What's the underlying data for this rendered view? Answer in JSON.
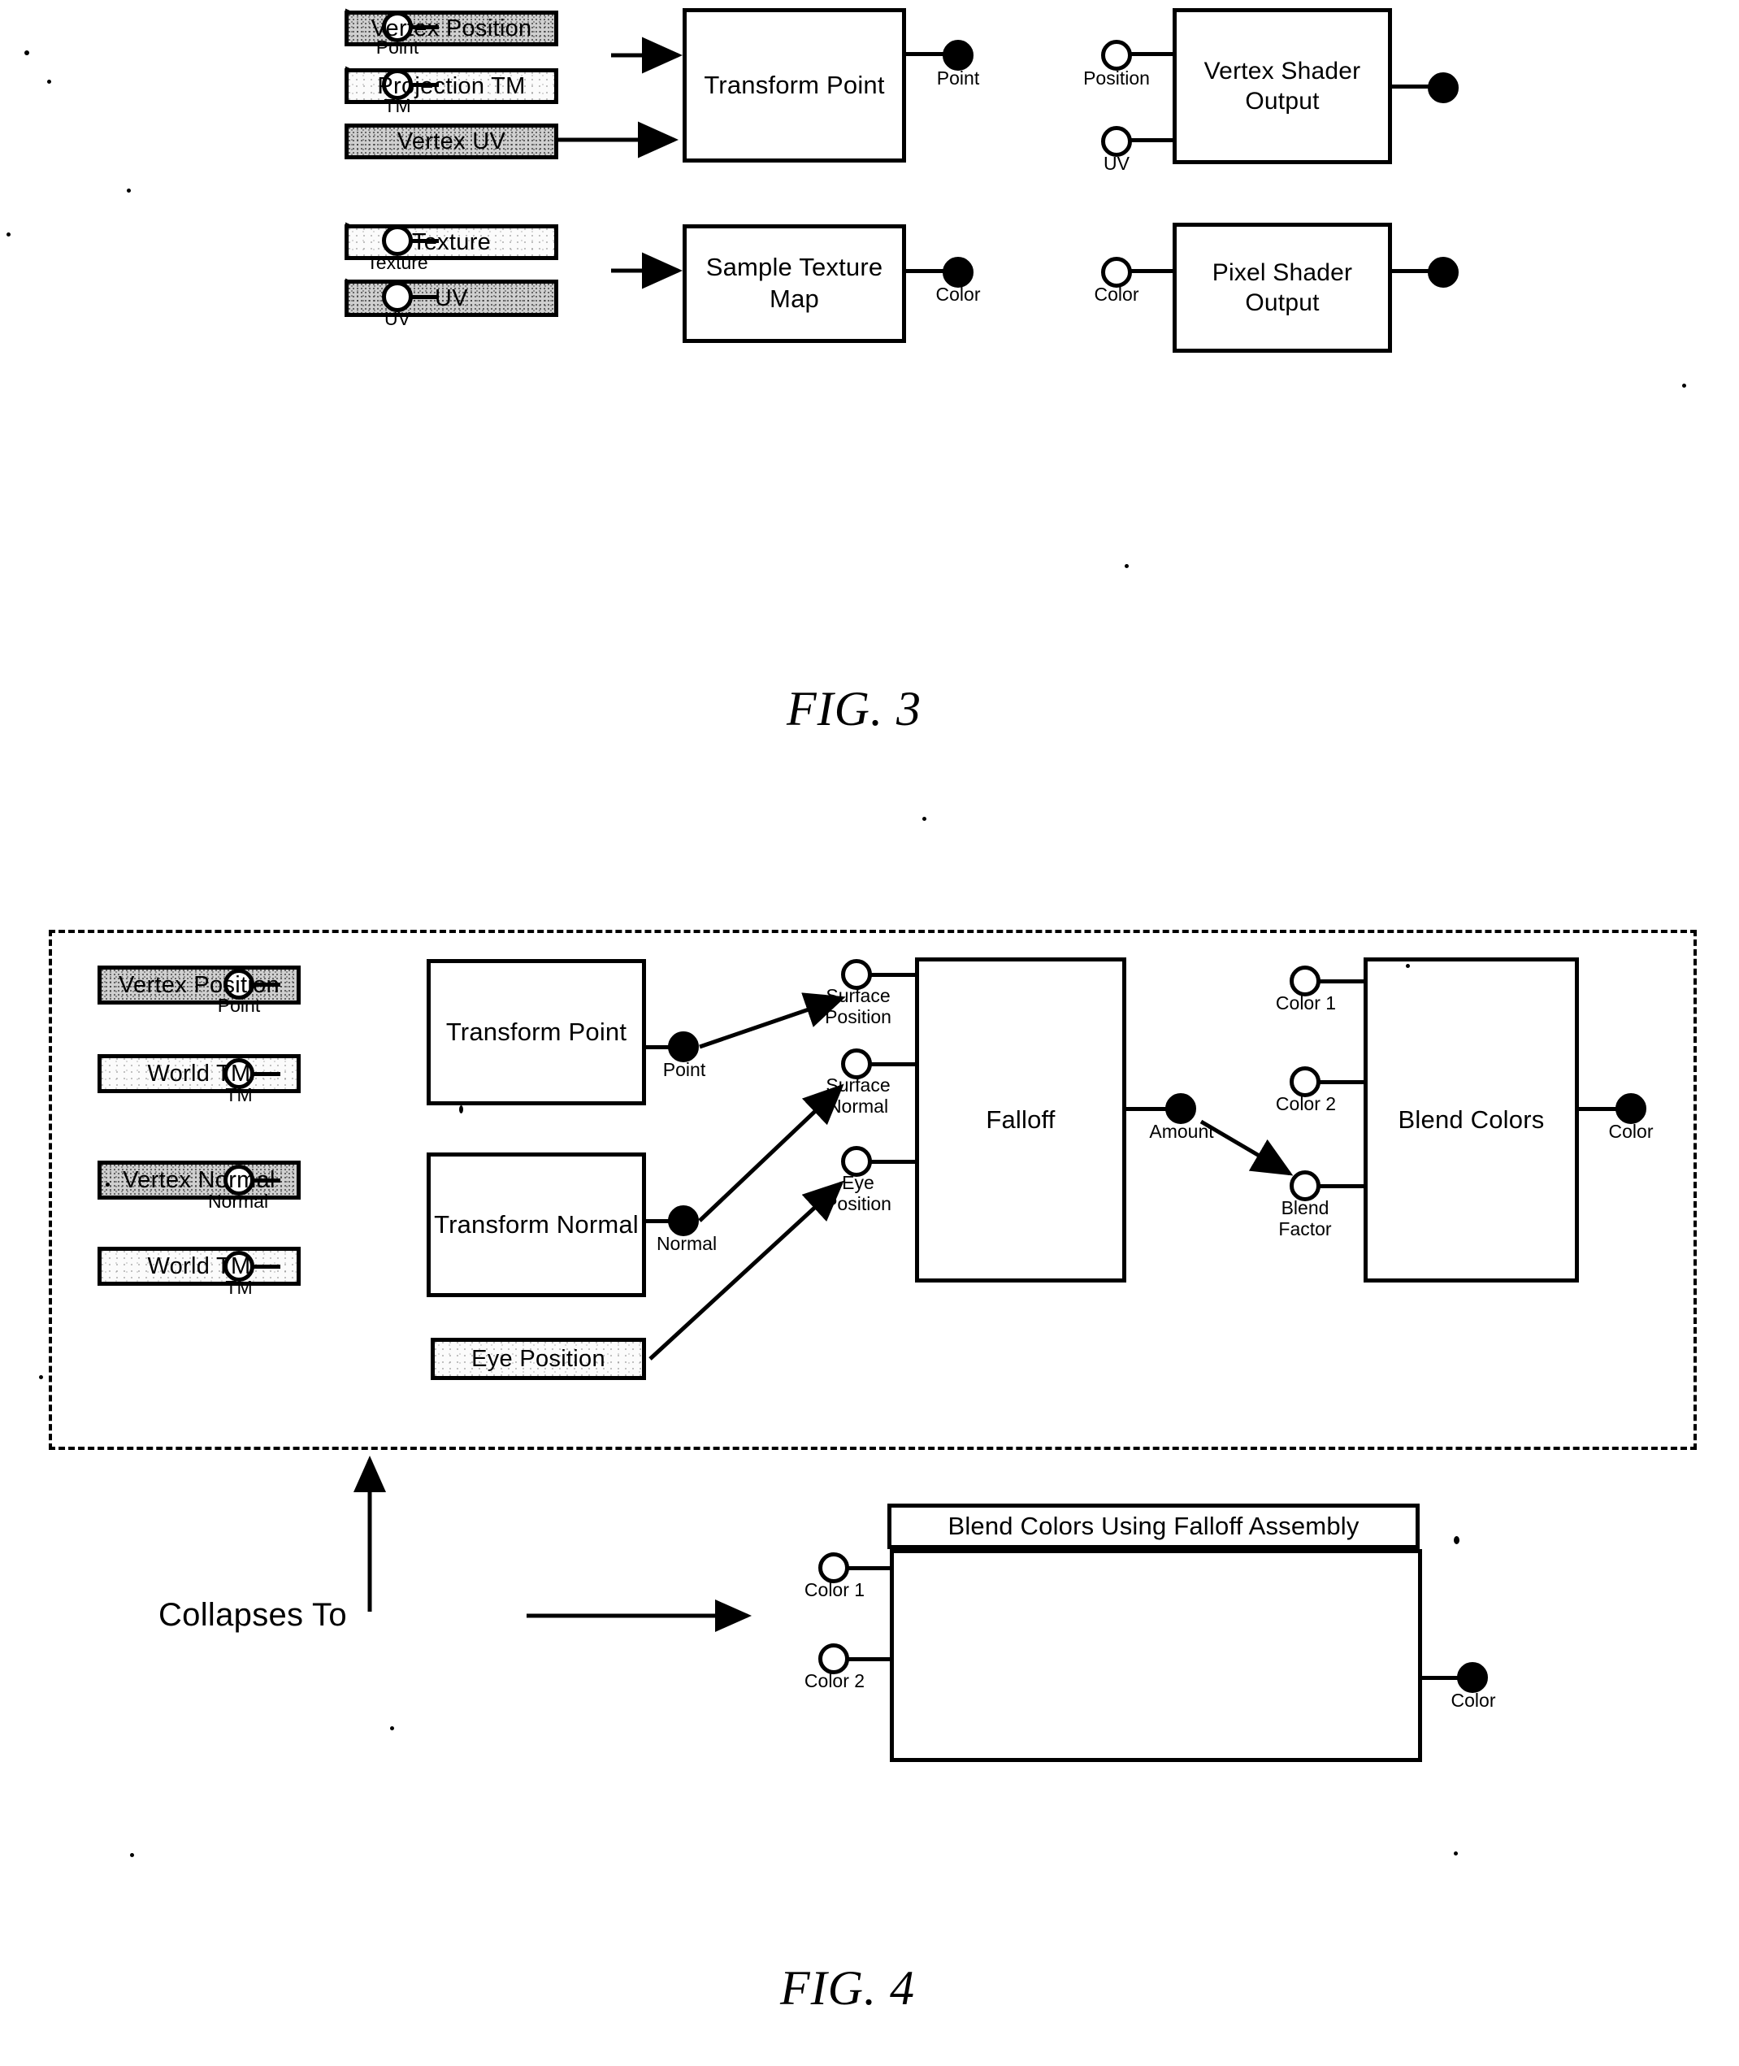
{
  "figures": [
    {
      "id": "fig3",
      "caption": "FIG. 3",
      "rows": [
        {
          "id": "vertex-shader-row",
          "sources": [
            {
              "label": "Vertex Position",
              "fill": "dark"
            },
            {
              "label": "Projection TM",
              "fill": "light"
            },
            {
              "label": "Vertex UV",
              "fill": "dark"
            }
          ],
          "process": {
            "label": "Transform Point"
          },
          "process_inputs": [
            "Point",
            "TM"
          ],
          "process_output": "Point",
          "sink": {
            "label": "Vertex Shader Output"
          },
          "sink_inputs": [
            "Position",
            "UV"
          ],
          "sink_output": ""
        },
        {
          "id": "pixel-shader-row",
          "sources": [
            {
              "label": "Texture",
              "fill": "light"
            },
            {
              "label": "UV",
              "fill": "dark"
            }
          ],
          "process": {
            "label": "Sample Texture Map"
          },
          "process_inputs": [
            "Texture",
            "UV"
          ],
          "process_output": "Color",
          "sink": {
            "label": "Pixel Shader Output"
          },
          "sink_inputs": [
            "Color"
          ],
          "sink_output": ""
        }
      ]
    },
    {
      "id": "fig4",
      "caption": "FIG. 4",
      "collapses_label": "Collapses To",
      "expanded": {
        "sources": [
          {
            "label": "Vertex Position",
            "fill": "dark"
          },
          {
            "label": "World TM",
            "fill": "light"
          },
          {
            "label": "Vertex Normal",
            "fill": "dark"
          },
          {
            "label": "World TM",
            "fill": "light"
          },
          {
            "label": "Eye Position",
            "fill": "light"
          }
        ],
        "nodes": [
          {
            "label": "Transform Point",
            "inputs": [
              "Point",
              "TM"
            ],
            "output": "Point"
          },
          {
            "label": "Transform Normal",
            "inputs": [
              "Normal",
              "TM"
            ],
            "output": "Normal"
          },
          {
            "label": "Falloff",
            "inputs": [
              "Surface Position",
              "Surface Normal",
              "Eye Position"
            ],
            "output": "Amount"
          },
          {
            "label": "Blend Colors",
            "inputs": [
              "Color 1",
              "Color 2",
              "Blend Factor"
            ],
            "output": "Color"
          }
        ]
      },
      "collapsed": {
        "title": "Blend Colors Using Falloff Assembly",
        "inputs": [
          "Color 1",
          "Color 2"
        ],
        "output": "Color"
      }
    }
  ],
  "labels": {
    "point": "Point",
    "tm": "TM",
    "uv": "UV",
    "position": "Position",
    "texture": "Texture",
    "color": "Color",
    "normal": "Normal",
    "surface_position": "Surface Position",
    "surface_normal": "Surface Normal",
    "eye_position": "Eye Position",
    "amount": "Amount",
    "color1": "Color 1",
    "color2": "Color 2",
    "blend_factor": "Blend Factor"
  },
  "colors": {
    "ink": "#000000",
    "paper": "#ffffff",
    "fill_dark": "#cfcfcf",
    "fill_light": "#fbfbfb"
  }
}
